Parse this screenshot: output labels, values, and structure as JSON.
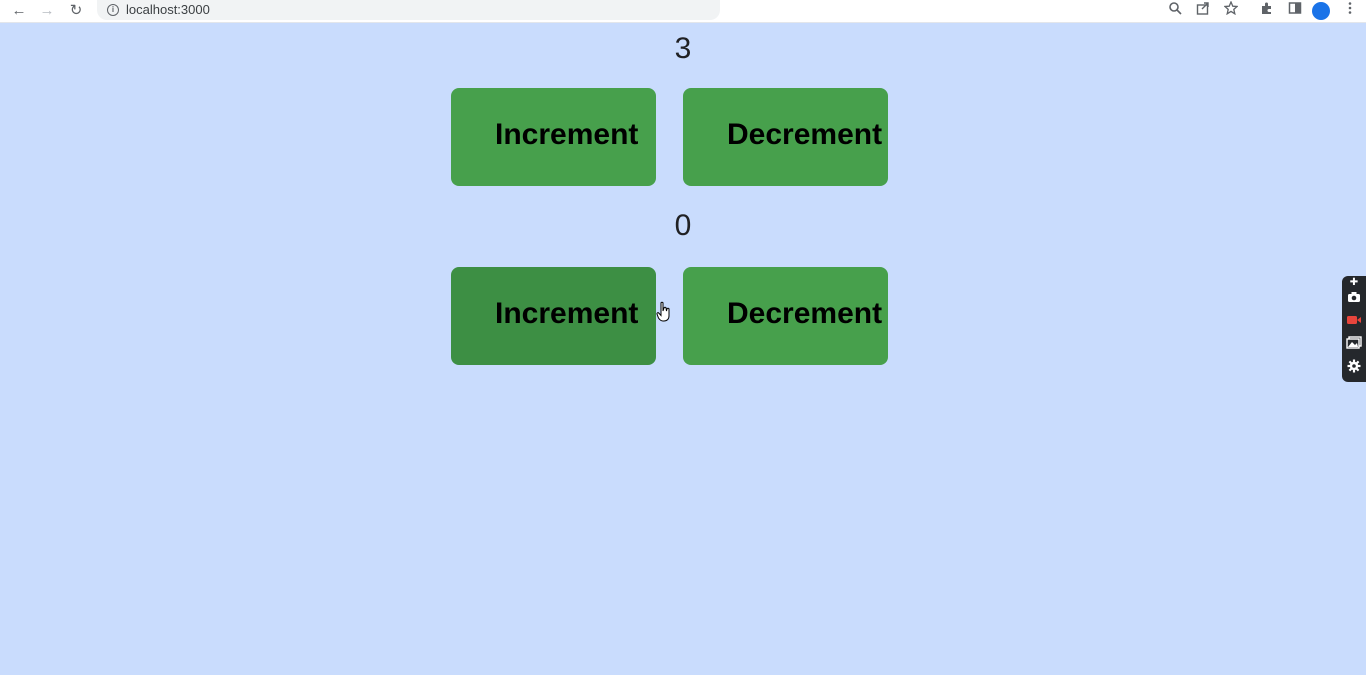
{
  "browser": {
    "url": "localhost:3000",
    "nav": {
      "back_icon": "←",
      "forward_icon": "→",
      "reload_icon": "↻"
    },
    "toolbar_icons": [
      "zoom-icon",
      "share-icon",
      "star-icon",
      "extensions-icon",
      "sidebar-icon",
      "profile-avatar",
      "menu-icon"
    ]
  },
  "counters": [
    {
      "value": "3",
      "increment_label": "Increment",
      "decrement_label": "Decrement"
    },
    {
      "value": "0",
      "increment_label": "Increment",
      "decrement_label": "Decrement"
    }
  ],
  "colors": {
    "page_background": "#c9dcfd",
    "button_green": "#47a04c",
    "button_green_hover": "#3d8f44"
  },
  "extension_panel": {
    "icons": [
      "pin-icon",
      "camera-icon",
      "video-record-icon",
      "gallery-icon",
      "settings-icon"
    ]
  }
}
